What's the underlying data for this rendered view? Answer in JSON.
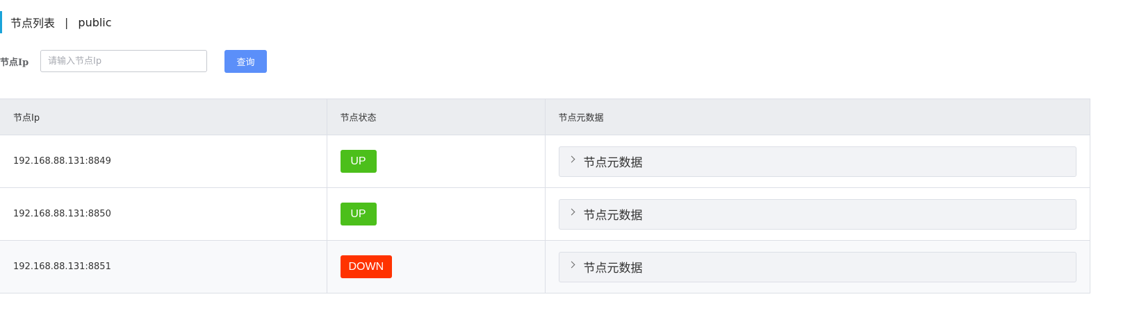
{
  "header": {
    "title": "节点列表",
    "separator": "|",
    "namespace": "public"
  },
  "search": {
    "label": "节点Ip",
    "placeholder": "请输入节点Ip",
    "value": "",
    "button_label": "查询"
  },
  "table": {
    "columns": [
      "节点Ip",
      "节点状态",
      "节点元数据"
    ],
    "rows": [
      {
        "ip": "192.168.88.131:8849",
        "status": "UP",
        "metadata_label": "节点元数据"
      },
      {
        "ip": "192.168.88.131:8850",
        "status": "UP",
        "metadata_label": "节点元数据"
      },
      {
        "ip": "192.168.88.131:8851",
        "status": "DOWN",
        "metadata_label": "节点元数据"
      }
    ]
  },
  "colors": {
    "accent": "#1aa3d9",
    "primary_button": "#5b8ff9",
    "status_up": "#4cbf1b",
    "status_down": "#ff3300"
  }
}
